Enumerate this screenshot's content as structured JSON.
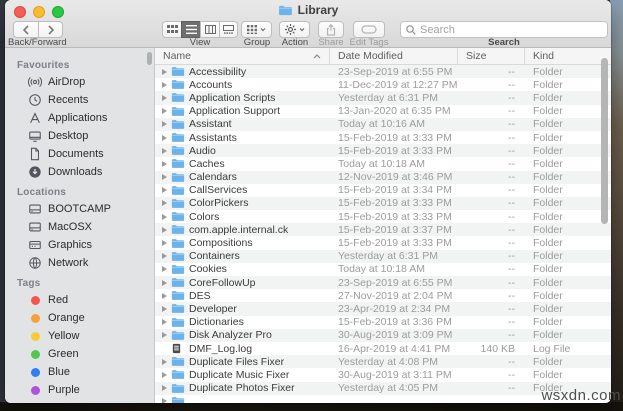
{
  "window": {
    "title": "Library"
  },
  "toolbar": {
    "back_forward_label": "Back/Forward",
    "view_label": "View",
    "group_label": "Group",
    "action_label": "Action",
    "share_label": "Share",
    "edit_tags_label": "Edit Tags",
    "search_label": "Search",
    "search_placeholder": "Search"
  },
  "sidebar": {
    "sections": [
      {
        "title": "Favourites",
        "items": [
          {
            "label": "AirDrop",
            "icon": "airdrop"
          },
          {
            "label": "Recents",
            "icon": "recents"
          },
          {
            "label": "Applications",
            "icon": "applications"
          },
          {
            "label": "Desktop",
            "icon": "desktop"
          },
          {
            "label": "Documents",
            "icon": "documents"
          },
          {
            "label": "Downloads",
            "icon": "downloads"
          }
        ]
      },
      {
        "title": "Locations",
        "items": [
          {
            "label": "BOOTCAMP",
            "icon": "drive"
          },
          {
            "label": "MacOSX",
            "icon": "drive"
          },
          {
            "label": "Graphics",
            "icon": "graphics"
          },
          {
            "label": "Network",
            "icon": "network"
          }
        ]
      },
      {
        "title": "Tags",
        "items": [
          {
            "label": "Red",
            "icon": "tag",
            "color": "#f6554e"
          },
          {
            "label": "Orange",
            "icon": "tag",
            "color": "#f7a239"
          },
          {
            "label": "Yellow",
            "icon": "tag",
            "color": "#f8ca38"
          },
          {
            "label": "Green",
            "icon": "tag",
            "color": "#53c84f"
          },
          {
            "label": "Blue",
            "icon": "tag",
            "color": "#2e7ef7"
          },
          {
            "label": "Purple",
            "icon": "tag",
            "color": "#af52de"
          }
        ]
      }
    ]
  },
  "table": {
    "columns": [
      "Name",
      "Date Modified",
      "Size",
      "Kind"
    ],
    "rows": [
      {
        "name": "Accessibility",
        "date": "23-Sep-2019 at 6:55 PM",
        "size": "--",
        "kind": "Folder",
        "icon": "folder"
      },
      {
        "name": "Accounts",
        "date": "11-Dec-2019 at 12:27 PM",
        "size": "--",
        "kind": "Folder",
        "icon": "folder"
      },
      {
        "name": "Application Scripts",
        "date": "Yesterday at 6:31 PM",
        "size": "--",
        "kind": "Folder",
        "icon": "folder"
      },
      {
        "name": "Application Support",
        "date": "13-Jan-2020 at 6:35 PM",
        "size": "--",
        "kind": "Folder",
        "icon": "folder"
      },
      {
        "name": "Assistant",
        "date": "Today at 10:16 AM",
        "size": "--",
        "kind": "Folder",
        "icon": "folder"
      },
      {
        "name": "Assistants",
        "date": "15-Feb-2019 at 3:33 PM",
        "size": "--",
        "kind": "Folder",
        "icon": "folder"
      },
      {
        "name": "Audio",
        "date": "15-Feb-2019 at 3:33 PM",
        "size": "--",
        "kind": "Folder",
        "icon": "folder"
      },
      {
        "name": "Caches",
        "date": "Today at 10:18 AM",
        "size": "--",
        "kind": "Folder",
        "icon": "folder"
      },
      {
        "name": "Calendars",
        "date": "12-Nov-2019 at 3:46 PM",
        "size": "--",
        "kind": "Folder",
        "icon": "folder"
      },
      {
        "name": "CallServices",
        "date": "15-Feb-2019 at 3:34 PM",
        "size": "--",
        "kind": "Folder",
        "icon": "folder"
      },
      {
        "name": "ColorPickers",
        "date": "15-Feb-2019 at 3:33 PM",
        "size": "--",
        "kind": "Folder",
        "icon": "folder"
      },
      {
        "name": "Colors",
        "date": "15-Feb-2019 at 3:33 PM",
        "size": "--",
        "kind": "Folder",
        "icon": "folder"
      },
      {
        "name": "com.apple.internal.ck",
        "date": "15-Feb-2019 at 3:37 PM",
        "size": "--",
        "kind": "Folder",
        "icon": "folder"
      },
      {
        "name": "Compositions",
        "date": "15-Feb-2019 at 3:33 PM",
        "size": "--",
        "kind": "Folder",
        "icon": "folder"
      },
      {
        "name": "Containers",
        "date": "Yesterday at 6:31 PM",
        "size": "--",
        "kind": "Folder",
        "icon": "folder"
      },
      {
        "name": "Cookies",
        "date": "Today at 10:18 AM",
        "size": "--",
        "kind": "Folder",
        "icon": "folder"
      },
      {
        "name": "CoreFollowUp",
        "date": "23-Sep-2019 at 6:55 PM",
        "size": "--",
        "kind": "Folder",
        "icon": "folder"
      },
      {
        "name": "DES",
        "date": "27-Nov-2019 at 2:04 PM",
        "size": "--",
        "kind": "Folder",
        "icon": "folder"
      },
      {
        "name": "Developer",
        "date": "23-Apr-2019 at 2:34 PM",
        "size": "--",
        "kind": "Folder",
        "icon": "folder"
      },
      {
        "name": "Dictionaries",
        "date": "15-Feb-2019 at 3:36 PM",
        "size": "--",
        "kind": "Folder",
        "icon": "folder"
      },
      {
        "name": "Disk Analyzer Pro",
        "date": "30-Aug-2019 at 3:09 PM",
        "size": "--",
        "kind": "Folder",
        "icon": "folder"
      },
      {
        "name": "DMF_Log.log",
        "date": "16-Apr-2019 at 4:41 PM",
        "size": "140 KB",
        "kind": "Log File",
        "icon": "logfile"
      },
      {
        "name": "Duplicate Files Fixer",
        "date": "Yesterday at 4:08 PM",
        "size": "--",
        "kind": "Folder",
        "icon": "folder"
      },
      {
        "name": "Duplicate Music Fixer",
        "date": "30-Aug-2019 at 3:11 PM",
        "size": "--",
        "kind": "Folder",
        "icon": "folder"
      },
      {
        "name": "Duplicate Photos Fixer",
        "date": "Yesterday at 4:05 PM",
        "size": "--",
        "kind": "Folder",
        "icon": "folder"
      },
      {
        "name": "",
        "date": "",
        "size": "",
        "kind": "",
        "icon": "folder"
      }
    ]
  },
  "watermark": "wsxdn.com"
}
